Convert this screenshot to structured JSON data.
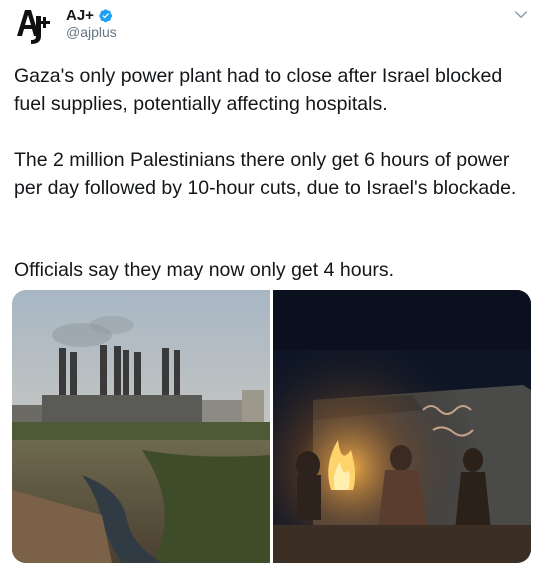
{
  "account": {
    "display_name": "AJ+",
    "handle": "@ajplus",
    "avatar_logo_text": "AJ+"
  },
  "tweet": {
    "paragraphs": [
      "Gaza's only power plant had to close after Israel blocked fuel supplies, potentially affecting hospitals.",
      "The 2 million Palestinians there only get 6 hours of power per day followed by 10-hour cuts, due to Israel's blockade.",
      "Officials say they may now only get 4 hours."
    ]
  },
  "media": {
    "images": [
      {
        "depicts": "power-plant-photo"
      },
      {
        "depicts": "family-by-fire-photo"
      }
    ]
  },
  "icons": {
    "verified": "verified-badge-icon",
    "menu": "chevron-down-icon"
  },
  "colors": {
    "text": "#14171a",
    "muted": "#657786",
    "verified": "#1da1f2"
  }
}
